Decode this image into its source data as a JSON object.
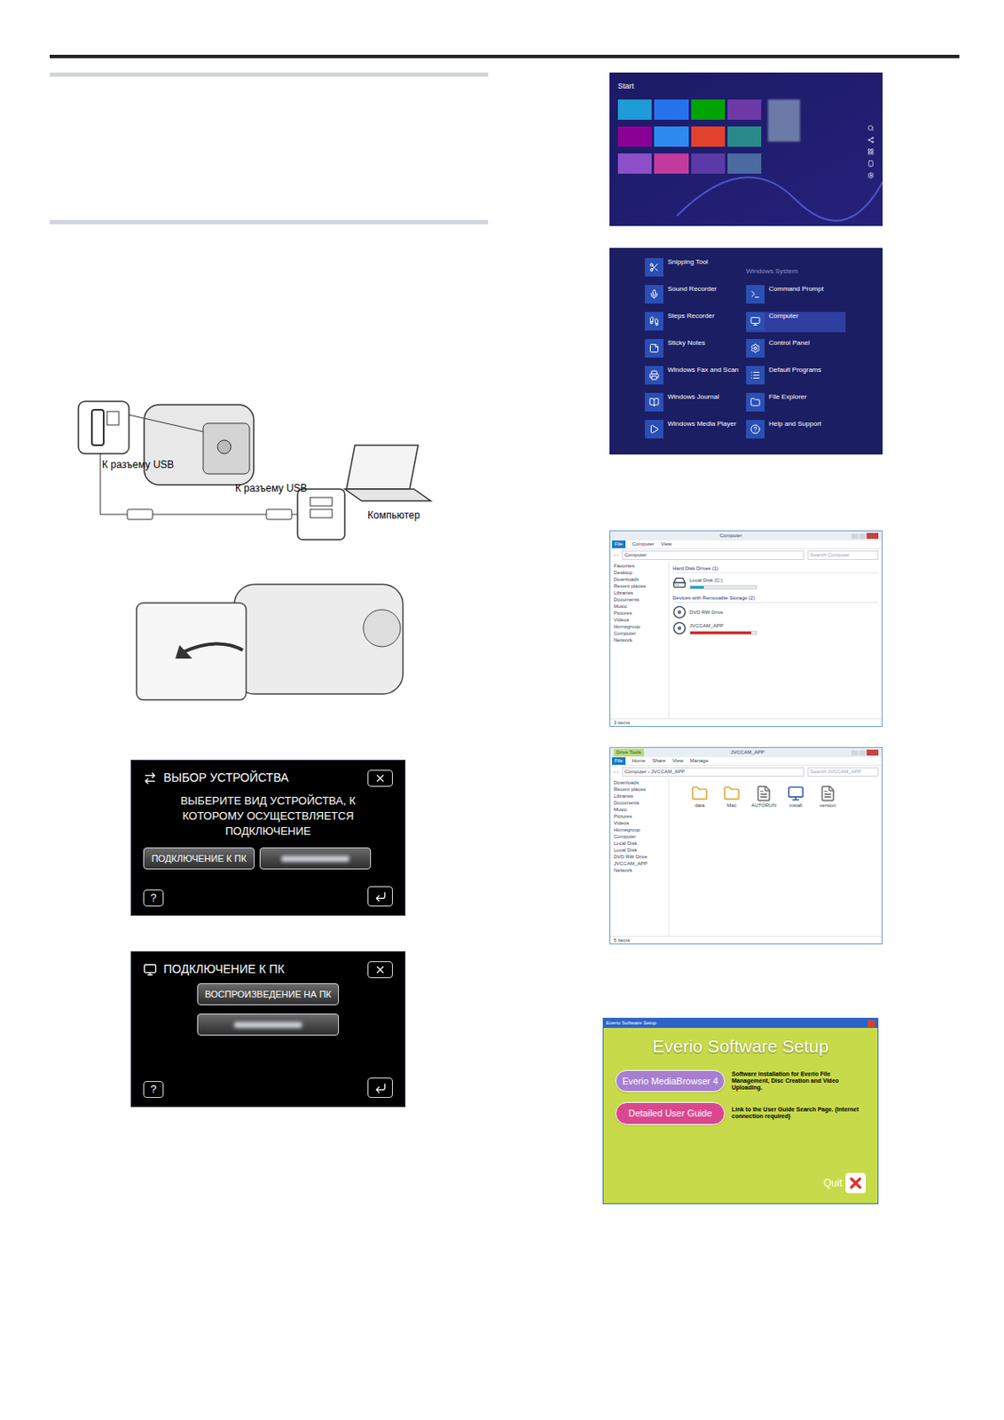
{
  "usb_diagram": {
    "camera_port_label": "К разъему USB",
    "pc_port_label": "К разъему USB",
    "computer_label": "Компьютер"
  },
  "device_select_screen": {
    "title": "ВЫБОР УСТРОЙСТВА",
    "message": "ВЫБЕРИТЕ ВИД УСТРОЙСТВА, К КОТОРОМУ ОСУЩЕСТВЛЯЕТСЯ ПОДКЛЮЧЕНИЕ",
    "buttons": [
      {
        "label": "ПОДКЛЮЧЕНИЕ К ПК",
        "blurred": false
      },
      {
        "label": "",
        "blurred": true
      }
    ],
    "help": "?"
  },
  "pc_connect_screen": {
    "title": "ПОДКЛЮЧЕНИЕ К ПК",
    "buttons": [
      {
        "label": "ВОСПРОИЗВЕДЕНИЕ НА ПК",
        "blurred": false
      },
      {
        "label": "",
        "blurred": true
      }
    ],
    "help": "?"
  },
  "start_screen": {
    "title": "Start",
    "tiles": [
      {
        "color": "#1f9bd7"
      },
      {
        "color": "#2672ec"
      },
      {
        "color": "#00a300"
      },
      {
        "color": "#6e3aa7"
      },
      {
        "color": "#8c0095"
      },
      {
        "color": "#2d89ef"
      },
      {
        "color": "#e3412b"
      },
      {
        "color": "#2a8a8a"
      },
      {
        "color": "#8c4fc7"
      },
      {
        "color": "#c33a9c"
      },
      {
        "color": "#5b3aa7"
      },
      {
        "color": "#4a6aa0"
      }
    ]
  },
  "apps_list": {
    "left_items": [
      {
        "label": "Snipping Tool",
        "selected": false
      },
      {
        "label": "Sound Recorder",
        "selected": false
      },
      {
        "label": "Steps Recorder",
        "selected": false
      },
      {
        "label": "Sticky Notes",
        "selected": false
      },
      {
        "label": "Windows Fax and Scan",
        "selected": false
      },
      {
        "label": "Windows Journal",
        "selected": false
      },
      {
        "label": "Windows Media Player",
        "selected": false
      }
    ],
    "right_header": "Windows System",
    "right_items": [
      {
        "label": "Command Prompt",
        "selected": false
      },
      {
        "label": "Computer",
        "selected": true
      },
      {
        "label": "Control Panel",
        "selected": false
      },
      {
        "label": "Default Programs",
        "selected": false
      },
      {
        "label": "File Explorer",
        "selected": false
      },
      {
        "label": "Help and Support",
        "selected": false
      }
    ]
  },
  "explorer_computer": {
    "title": "Computer",
    "ribbon_tabs": [
      "File",
      "Computer",
      "View"
    ],
    "address": "Computer",
    "search": "Search Computer",
    "sidebar": [
      "Favorites",
      "Desktop",
      "Downloads",
      "Recent places",
      "Libraries",
      "Documents",
      "Music",
      "Pictures",
      "Videos",
      "Homegroup",
      "Computer",
      "Network"
    ],
    "groups": [
      {
        "header": "Hard Disk Drives (1)",
        "drives": [
          {
            "name": "Local Disk (C:)",
            "level": 0.2,
            "color": "#26a0da"
          }
        ]
      },
      {
        "header": "Devices with Removable Storage (2)",
        "drives": [
          {
            "name": "DVD RW Drive",
            "level": 0,
            "color": "#26a0da"
          },
          {
            "name": "JVCCAM_APP",
            "level": 0.92,
            "color": "#da2626"
          }
        ]
      }
    ],
    "status": "3 items"
  },
  "explorer_drive": {
    "title": "JVCCAM_APP",
    "context_tab": "Drive Tools",
    "ribbon_tabs": [
      "File",
      "Home",
      "Share",
      "View",
      "Manage"
    ],
    "address": "Computer › JVCCAM_APP",
    "search": "Search JVCCAM_APP",
    "sidebar": [
      "Downloads",
      "Recent places",
      "Libraries",
      "Documents",
      "Music",
      "Pictures",
      "Videos",
      "Homegroup",
      "Computer",
      "Local Disk",
      "Local Disk",
      "DVD RW Drive",
      "JVCCAM_APP",
      "Network"
    ],
    "files": [
      {
        "name": "data",
        "kind": "folder"
      },
      {
        "name": "Mac",
        "kind": "folder"
      },
      {
        "name": "AUTORUN",
        "kind": "file"
      },
      {
        "name": "install",
        "kind": "app"
      },
      {
        "name": "version",
        "kind": "file"
      }
    ],
    "status": "5 items"
  },
  "everio_setup": {
    "window_title": "Everio Software Setup",
    "heading": "Everio Software Setup",
    "buttons": [
      {
        "label": "Everio MediaBrowser 4",
        "description": "Software installation for Everio File Management, Disc Creation and Video Uploading.",
        "color": "#a77fd0"
      },
      {
        "label": "Detailed User Guide",
        "description": "Link to the User Guide Search Page. (Internet connection required)",
        "color": "#d9488f"
      }
    ],
    "quit": "Quit"
  }
}
